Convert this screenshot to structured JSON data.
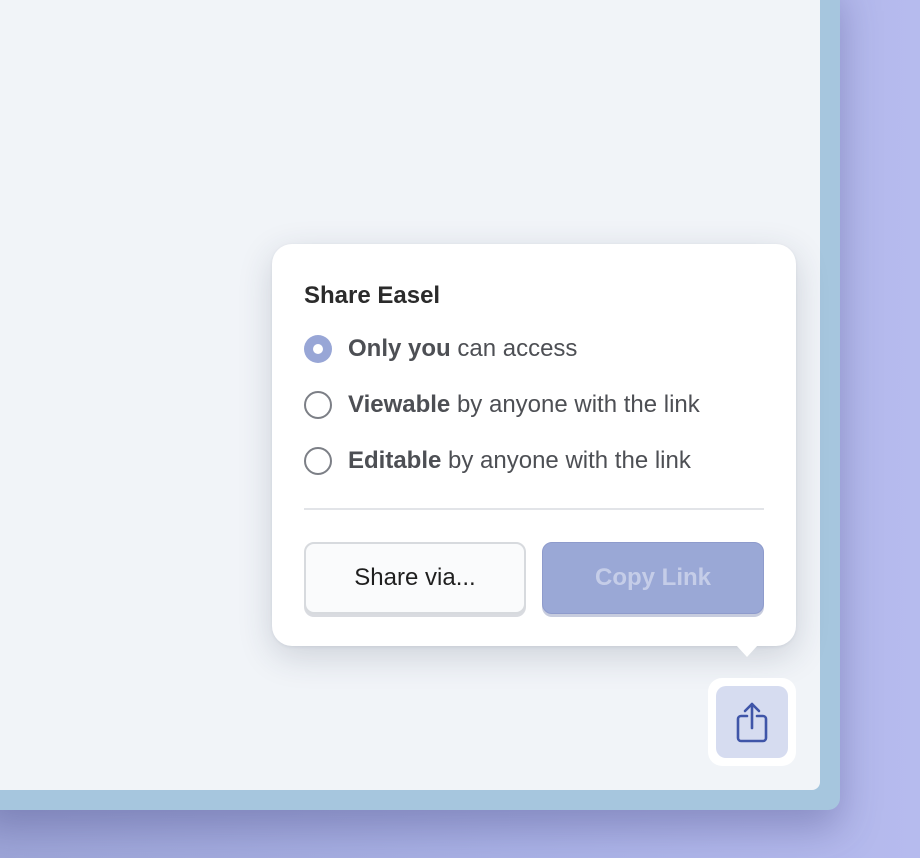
{
  "share_popover": {
    "title": "Share Easel",
    "options": [
      {
        "bold": "Only you",
        "rest": " can access",
        "selected": true
      },
      {
        "bold": "Viewable",
        "rest": " by anyone with the link",
        "selected": false
      },
      {
        "bold": "Editable",
        "rest": " by anyone with the link",
        "selected": false
      }
    ],
    "share_via_label": "Share via...",
    "copy_link_label": "Copy Link"
  },
  "toolbar": {
    "share_icon": "share-icon"
  },
  "colors": {
    "accent": "#98a6d6",
    "background": "#b6bbee",
    "canvas": "#f1f4f8",
    "window_border": "#a6c6de"
  }
}
